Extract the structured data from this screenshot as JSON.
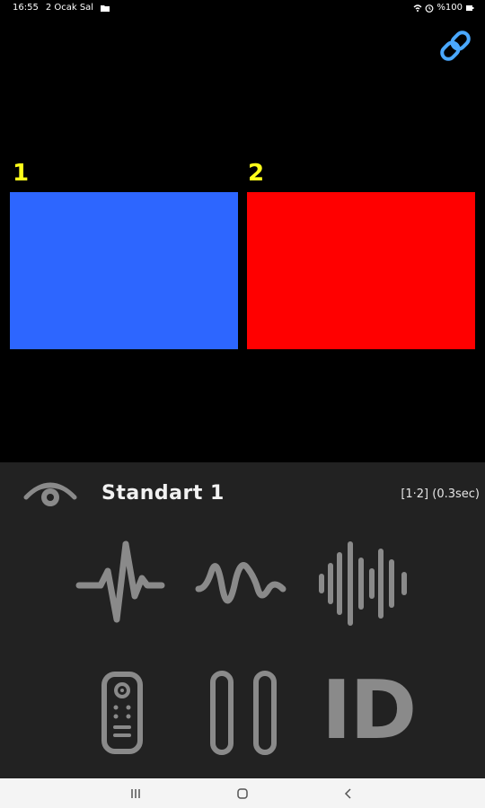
{
  "status_bar": {
    "time": "16:55",
    "date": "2 Ocak Sal",
    "battery": "%100"
  },
  "panels": [
    {
      "label": "1",
      "color": "#2d66ff"
    },
    {
      "label": "2",
      "color": "#ff0000"
    }
  ],
  "control": {
    "mode_title": "Standart 1",
    "info": "[1·2] (0.3sec)",
    "id_label": "ID"
  },
  "colors": {
    "background": "#000000",
    "panel_label": "#ffff1a",
    "control_bg": "#222222",
    "icon_gray": "#8a8a8a",
    "link_blue": "#4aa8ff"
  },
  "icons": {
    "link": "link-icon",
    "eye": "eye-icon",
    "pulse": "heartbeat-icon",
    "wave": "wave-icon",
    "sound": "soundwave-icon",
    "remote": "remote-icon",
    "pause": "pause-icon"
  }
}
